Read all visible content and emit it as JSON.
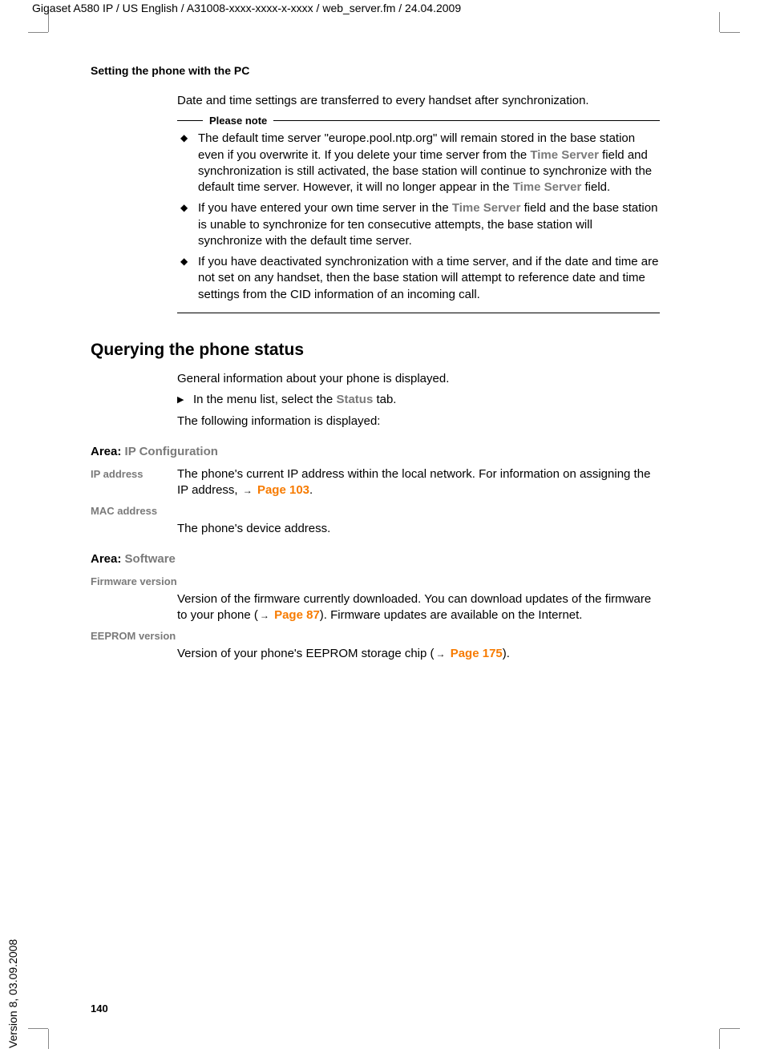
{
  "header": "Gigaset A580 IP / US English / A31008-xxxx-xxxx-x-xxxx / web_server.fm / 24.04.2009",
  "section_heading": "Setting the phone with the PC",
  "intro": "Date and time settings are transferred to every handset after synchronization.",
  "note_label": "Please note",
  "note_items": {
    "i1_a": "The default time server \"europe.pool.ntp.org\" will remain stored in the base station even if you overwrite it. If you delete your time server from the ",
    "i1_b": " field and synchronization is still activated, the base station will continue to synchronize with the default time server. However, it will no longer appear in the ",
    "i1_c": " field.",
    "i2_a": "If you have entered your own time server in the ",
    "i2_b": " field and the base station is unable to synchronize for ten consecutive attempts, the base station will synchronize with the default time server.",
    "i3": "If you have deactivated synchronization with a time server, and if the date and time are not set on any handset, then the base station will attempt to reference date and time settings from the CID information of an incoming call."
  },
  "term_time_server": "Time Server",
  "h2": "Querying the phone status",
  "general_info": "General information about your phone is displayed.",
  "step_a": "In the menu list, select the ",
  "status_term": "Status",
  "step_b": " tab.",
  "following": "The following information is displayed:",
  "area1_label": "Area: ",
  "area1_value": "IP Configuration",
  "ip_address_label": "IP address",
  "ip_address_a": "The phone's current IP address within the local network. For information on assigning the IP address, ",
  "ip_address_link": "Page 103",
  "mac_label": "MAC address",
  "mac_desc": "The phone's device address.",
  "area2_label": "Area: ",
  "area2_value": "Software",
  "fw_label": "Firmware version",
  "fw_a": "Version of the firmware currently downloaded. You can download updates of the firmware to your phone (",
  "fw_link": "Page 87",
  "fw_b": "). Firmware updates are available on the Internet.",
  "ee_label": "EEPROM version",
  "ee_a": "Version of your phone's EEPROM storage chip (",
  "ee_link": "Page 175",
  "ee_b": ").",
  "page_number": "140",
  "version_text": "Version 8, 03.09.2008"
}
